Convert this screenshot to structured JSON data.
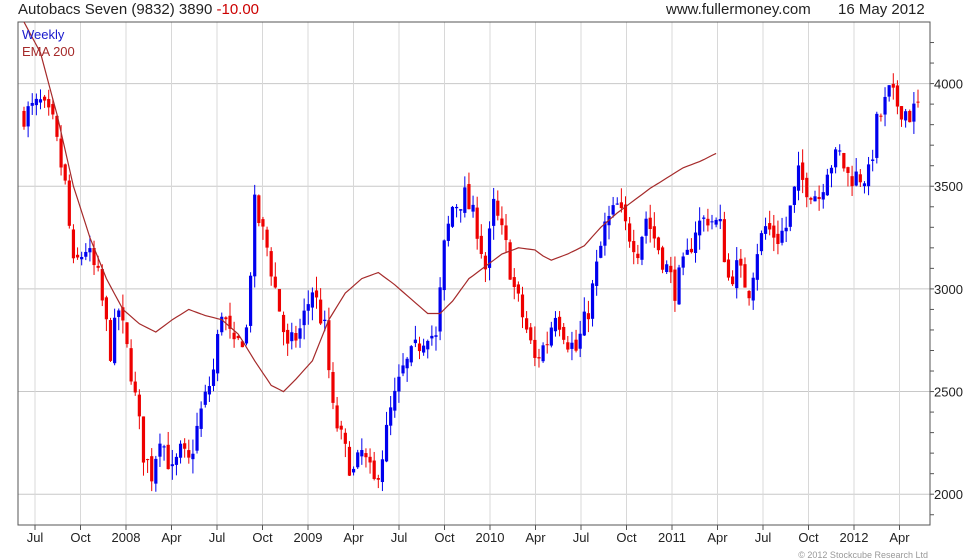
{
  "header": {
    "title": "Autobacs Seven (9832) 3890",
    "change": "-10.00",
    "site": "www.fullermoney.com",
    "date": "16 May 2012"
  },
  "copyright": "© 2012 Stockcube Research Ltd",
  "chart_data": {
    "type": "candlestick",
    "legend": [
      {
        "name": "Weekly",
        "color": "#1a1acc"
      },
      {
        "name": "EMA 200",
        "color": "#a52a2a"
      }
    ],
    "colors": {
      "up": "#0000ee",
      "down": "#ee0000",
      "ema": "#a52a2a"
    },
    "ylim": [
      1850,
      4300
    ],
    "y_ticks": [
      2000,
      2500,
      3000,
      3500,
      4000
    ],
    "x_ticks": [
      "Jul",
      "Oct",
      "2008",
      "Apr",
      "Jul",
      "Oct",
      "2009",
      "Apr",
      "Jul",
      "Oct",
      "2010",
      "Apr",
      "Jul",
      "Oct",
      "2011",
      "Apr",
      "Jul",
      "Oct",
      "2012",
      "Apr"
    ],
    "grid": true,
    "legend_position": "top-left",
    "close_path": [
      [
        0,
        3850
      ],
      [
        4,
        3900
      ],
      [
        7,
        3800
      ],
      [
        10,
        3500
      ],
      [
        12,
        3100
      ],
      [
        15,
        3200
      ],
      [
        18,
        3050
      ],
      [
        21,
        2700
      ],
      [
        23,
        2900
      ],
      [
        26,
        2600
      ],
      [
        29,
        2200
      ],
      [
        31,
        2100
      ],
      [
        33,
        2300
      ],
      [
        36,
        2100
      ],
      [
        38,
        2200
      ],
      [
        40,
        2150
      ],
      [
        43,
        2400
      ],
      [
        46,
        2600
      ],
      [
        48,
        2900
      ],
      [
        51,
        2700
      ],
      [
        54,
        2800
      ],
      [
        56,
        3400
      ],
      [
        59,
        3200
      ],
      [
        61,
        3000
      ],
      [
        64,
        2700
      ],
      [
        67,
        2800
      ],
      [
        70,
        3000
      ],
      [
        73,
        2800
      ],
      [
        75,
        2400
      ],
      [
        78,
        2200
      ],
      [
        80,
        2100
      ],
      [
        82,
        2200
      ],
      [
        85,
        2050
      ],
      [
        87,
        2200
      ],
      [
        89,
        2400
      ],
      [
        92,
        2600
      ],
      [
        95,
        2700
      ],
      [
        98,
        2800
      ],
      [
        100,
        2750
      ],
      [
        102,
        3200
      ],
      [
        104,
        3400
      ],
      [
        107,
        3450
      ],
      [
        110,
        3300
      ],
      [
        112,
        3100
      ],
      [
        114,
        3400
      ],
      [
        117,
        3200
      ],
      [
        119,
        3000
      ],
      [
        122,
        2800
      ],
      [
        124,
        2650
      ],
      [
        127,
        2750
      ],
      [
        129,
        2900
      ],
      [
        132,
        2750
      ],
      [
        134,
        2700
      ],
      [
        137,
        2900
      ],
      [
        139,
        3100
      ],
      [
        141,
        3300
      ],
      [
        144,
        3400
      ],
      [
        146,
        3300
      ],
      [
        149,
        3200
      ],
      [
        151,
        3350
      ],
      [
        154,
        3200
      ],
      [
        156,
        3100
      ],
      [
        158,
        3000
      ],
      [
        161,
        3150
      ],
      [
        163,
        3300
      ],
      [
        166,
        3350
      ],
      [
        169,
        3300
      ],
      [
        171,
        3050
      ],
      [
        173,
        3100
      ],
      [
        176,
        3000
      ],
      [
        178,
        3200
      ],
      [
        180,
        3300
      ],
      [
        183,
        3250
      ],
      [
        185,
        3300
      ],
      [
        188,
        3550
      ],
      [
        190,
        3500
      ],
      [
        193,
        3450
      ],
      [
        195,
        3600
      ],
      [
        198,
        3650
      ],
      [
        200,
        3550
      ],
      [
        202,
        3550
      ],
      [
        205,
        3550
      ],
      [
        207,
        3800
      ],
      [
        210,
        3950
      ],
      [
        212,
        3900
      ],
      [
        215,
        3850
      ],
      [
        217,
        3890
      ]
    ],
    "ema200_path": [
      [
        0,
        4300
      ],
      [
        4,
        4150
      ],
      [
        8,
        3850
      ],
      [
        12,
        3500
      ],
      [
        16,
        3250
      ],
      [
        20,
        3050
      ],
      [
        24,
        2900
      ],
      [
        28,
        2830
      ],
      [
        32,
        2790
      ],
      [
        36,
        2850
      ],
      [
        40,
        2900
      ],
      [
        44,
        2870
      ],
      [
        48,
        2850
      ],
      [
        52,
        2780
      ],
      [
        56,
        2650
      ],
      [
        60,
        2530
      ],
      [
        63,
        2500
      ],
      [
        66,
        2560
      ],
      [
        70,
        2650
      ],
      [
        74,
        2850
      ],
      [
        78,
        2980
      ],
      [
        82,
        3050
      ],
      [
        86,
        3080
      ],
      [
        90,
        3020
      ],
      [
        94,
        2950
      ],
      [
        98,
        2880
      ],
      [
        101,
        2880
      ],
      [
        104,
        2940
      ],
      [
        108,
        3050
      ],
      [
        112,
        3110
      ],
      [
        116,
        3170
      ],
      [
        120,
        3200
      ],
      [
        124,
        3190
      ],
      [
        126,
        3160
      ],
      [
        128,
        3140
      ],
      [
        132,
        3170
      ],
      [
        136,
        3210
      ],
      [
        140,
        3300
      ],
      [
        144,
        3370
      ],
      [
        148,
        3430
      ],
      [
        152,
        3490
      ],
      [
        156,
        3540
      ],
      [
        160,
        3590
      ],
      [
        164,
        3620
      ],
      [
        168,
        3660
      ]
    ]
  }
}
